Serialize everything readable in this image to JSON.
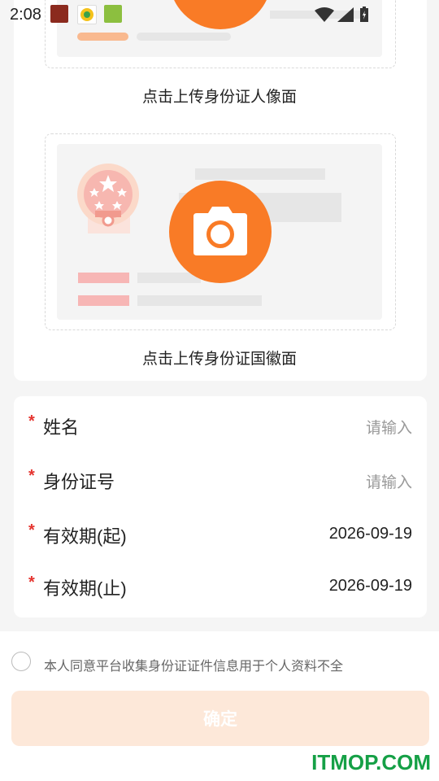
{
  "status_bar": {
    "time": "2:08"
  },
  "upload": {
    "front_caption": "点击上传身份证人像面",
    "back_caption": "点击上传身份证国徽面"
  },
  "form": {
    "rows": [
      {
        "label": "姓名",
        "value": "请输入",
        "is_placeholder": true
      },
      {
        "label": "身份证号",
        "value": "请输入",
        "is_placeholder": true
      },
      {
        "label": "有效期(起)",
        "value": "2026-09-19",
        "is_placeholder": false
      },
      {
        "label": "有效期(止)",
        "value": "2026-09-19",
        "is_placeholder": false
      }
    ],
    "required_mark": "*"
  },
  "consent": {
    "text": "本人同意平台收集身份证证件信息用于个人资料不全",
    "checked": false
  },
  "confirm_button": {
    "label": "确定"
  },
  "watermark": {
    "text": "ITMOP.COM"
  },
  "colors": {
    "accent": "#f97b26",
    "required": "#e5342f",
    "button_disabled_bg": "#fde8d9",
    "watermark": "#15a046"
  }
}
